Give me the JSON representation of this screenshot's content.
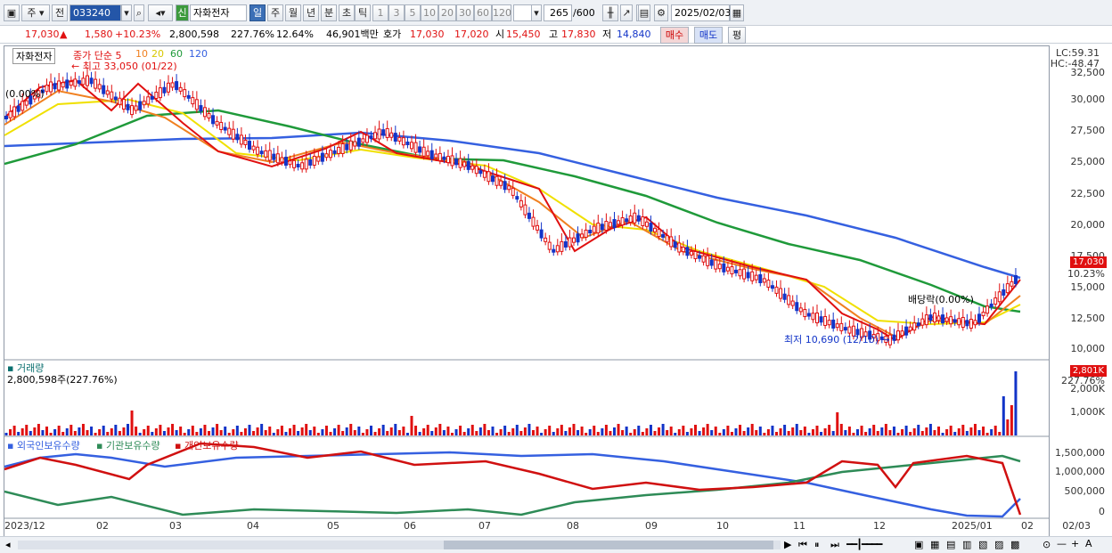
{
  "toolbar": {
    "period": "주",
    "market": "전",
    "code": "033240",
    "new_badge": "신",
    "stock_name": "자화전자",
    "tabs": [
      "일",
      "주",
      "월",
      "년",
      "분",
      "초",
      "틱"
    ],
    "active_tab": "일",
    "intervals": [
      "1",
      "3",
      "5",
      "10",
      "20",
      "30",
      "60",
      "120"
    ],
    "bar_count": "265",
    "bar_total": "/600",
    "date": "2025/02/03"
  },
  "quote": {
    "price": "17,030",
    "change": "1,580",
    "change_pct": "+10.23%",
    "volume": "2,800,598",
    "volume_ratio": "227.76%",
    "turnover": "12.64%",
    "amount": "46,901백만",
    "bid_label": "호가",
    "ask": "17,030",
    "bid": "17,020",
    "open_label": "시",
    "open": "15,450",
    "high_label": "고",
    "high": "17,830",
    "low_label": "저",
    "low": "14,840",
    "buy_label": "매수",
    "sell_label": "매도",
    "avg_label": "평"
  },
  "price_panel": {
    "name": "자화전자",
    "ma_label": "종가 단순 5",
    "ma_periods": [
      "10",
      "20",
      "60",
      "120"
    ],
    "high_note": "최고 33,050 (01/22)",
    "low_note": "최저 10,690 (12/10)",
    "left_note": "(0.00%)",
    "dividend_note": "배당락(0.00%)",
    "lc": "LC:59.31",
    "hc": "HC:-48.47",
    "current_tag": "17,030",
    "current_pct": "10.23%",
    "y_ticks": [
      "32,500",
      "30,000",
      "27,500",
      "25,000",
      "22,500",
      "20,000",
      "17,500",
      "15,000",
      "12,500",
      "10,000"
    ]
  },
  "volume_panel": {
    "title": "거래량",
    "value": "2,800,598주(227.76%)",
    "tag": "2,801K",
    "tag_pct": "227.76%",
    "y_ticks": [
      "2,000K",
      "1,000K"
    ]
  },
  "holding_panel": {
    "series": [
      "외국인보유수량",
      "기관보유수량",
      "개인보유수량"
    ],
    "y_ticks": [
      "1,500,000",
      "1,000,000",
      "500,000",
      "0"
    ]
  },
  "x_ticks": [
    "2023/12",
    "02",
    "03",
    "04",
    "05",
    "06",
    "07",
    "08",
    "09",
    "10",
    "11",
    "12",
    "2025/01",
    "02",
    "02/03"
  ],
  "colors": {
    "up": "#e01010",
    "down": "#1234c8",
    "ma5": "#e01010",
    "ma10": "#f08020",
    "ma20": "#f0e000",
    "ma60": "#1f9a3a",
    "ma120": "#3560e0",
    "foreign": "#3560e0",
    "institution": "#2e8b57",
    "individual": "#d01010"
  }
}
